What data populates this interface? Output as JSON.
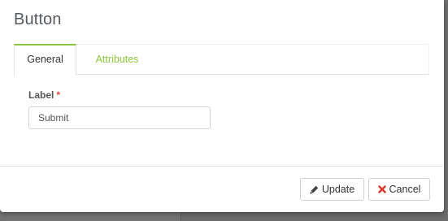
{
  "dialog": {
    "title": "Button"
  },
  "tabs": [
    {
      "label": "General",
      "active": true
    },
    {
      "label": "Attributes",
      "active": false
    }
  ],
  "form": {
    "label_field": {
      "label": "Label",
      "required_mark": "*",
      "value": "Submit"
    }
  },
  "footer": {
    "update_label": "Update",
    "update_icon": "pencil-icon",
    "cancel_label": "Cancel",
    "cancel_icon": "close-icon"
  },
  "colors": {
    "accent": "#8cc63e",
    "required": "#e0503c",
    "cancel_icon": "#d9352a"
  }
}
